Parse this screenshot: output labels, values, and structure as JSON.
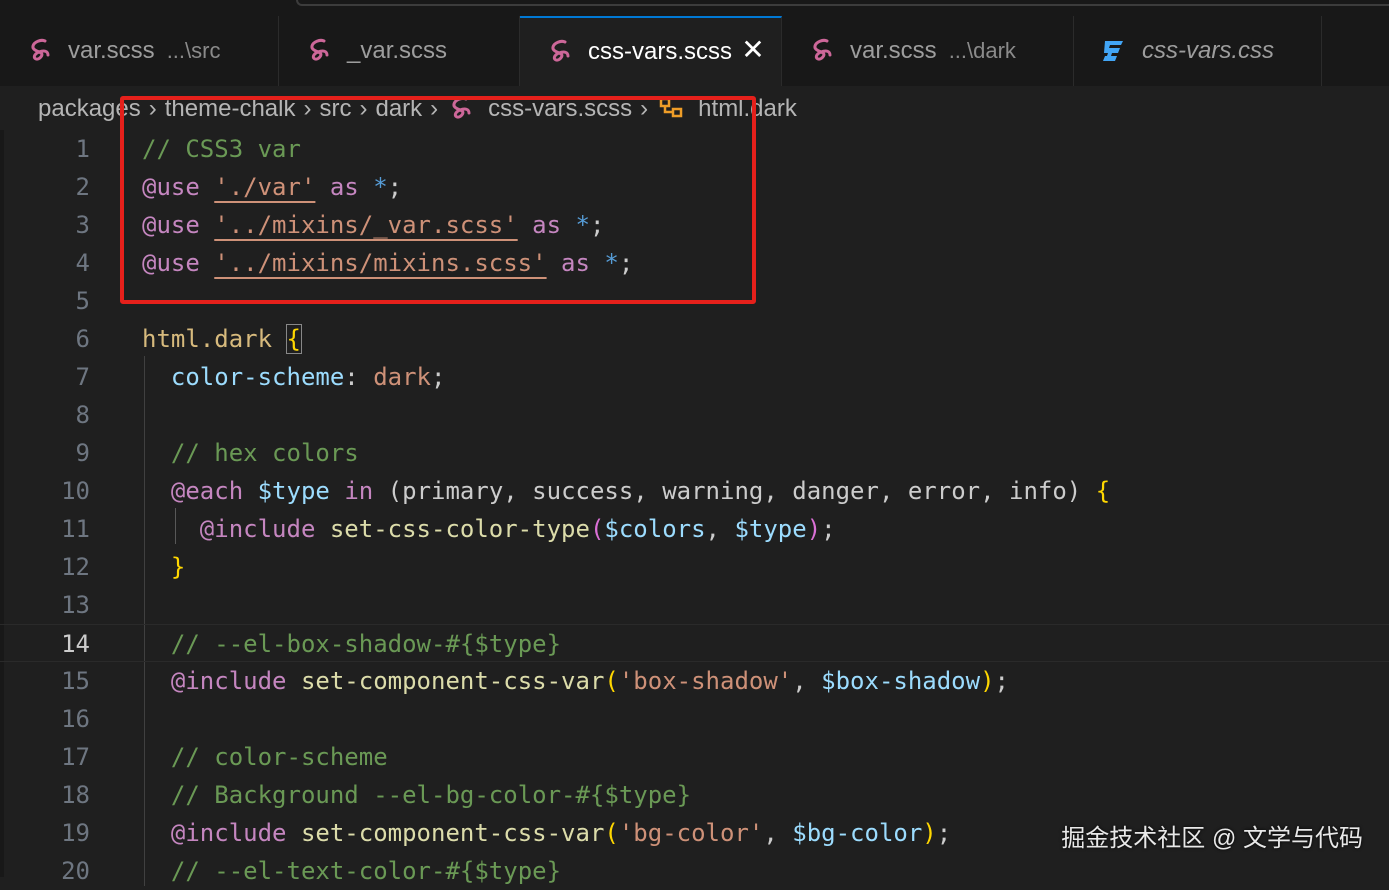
{
  "tabs": [
    {
      "name": "var.scss",
      "desc": "...\\src",
      "icon": "sass-icon",
      "active": false
    },
    {
      "name": "_var.scss",
      "desc": "",
      "icon": "sass-icon",
      "active": false
    },
    {
      "name": "css-vars.scss",
      "desc": "",
      "icon": "sass-icon",
      "active": true
    },
    {
      "name": "var.scss",
      "desc": "...\\dark",
      "icon": "sass-icon",
      "active": false
    },
    {
      "name": "css-vars.css",
      "desc": "",
      "icon": "css3-icon",
      "active": false
    }
  ],
  "breadcrumb": {
    "items": [
      "packages",
      "theme-chalk",
      "src",
      "dark",
      "css-vars.scss",
      "html.dark"
    ]
  },
  "editor": {
    "current_line": "14",
    "line_numbers": [
      "1",
      "2",
      "3",
      "4",
      "5",
      "6",
      "7",
      "8",
      "9",
      "10",
      "11",
      "12",
      "13",
      "14",
      "15",
      "16",
      "17",
      "18",
      "19",
      "20"
    ],
    "lines": {
      "l1": {
        "comment": "// CSS3 var"
      },
      "l2": {
        "at": "@use",
        "str": "'./var'",
        "kw": "as",
        "star": "*",
        "semi": ";"
      },
      "l3": {
        "at": "@use",
        "str": "'../mixins/_var.scss'",
        "kw": "as",
        "star": "*",
        "semi": ";"
      },
      "l4": {
        "at": "@use",
        "str": "'../mixins/mixins.scss'",
        "kw": "as",
        "star": "*",
        "semi": ";"
      },
      "l6": {
        "sel": "html.dark",
        "brace": "{"
      },
      "l7": {
        "prop": "color-scheme",
        "colon": ":",
        "val": "dark",
        "semi": ";"
      },
      "l9": {
        "comment": "// hex colors"
      },
      "l10": {
        "at": "@each",
        "var": "$type",
        "kw": "in",
        "list": "(primary, success, warning, danger, error, info)",
        "brace": "{"
      },
      "l11": {
        "at": "@include",
        "func": "set-css-color-type",
        "open": "(",
        "arg1": "$colors",
        "comma": ", ",
        "arg2": "$type",
        "close": ")",
        "semi": ";"
      },
      "l12": {
        "brace": "}"
      },
      "l14": {
        "comment": "// --el-box-shadow-#{$type}"
      },
      "l15": {
        "at": "@include",
        "func": "set-component-css-var",
        "open": "(",
        "str": "'box-shadow'",
        "comma": ", ",
        "arg": "$box-shadow",
        "close": ")",
        "semi": ";"
      },
      "l17": {
        "comment": "// color-scheme"
      },
      "l18": {
        "comment": "// Background --el-bg-color-#{$type}"
      },
      "l19": {
        "at": "@include",
        "func": "set-component-css-var",
        "open": "(",
        "str": "'bg-color'",
        "comma": ", ",
        "arg": "$bg-color",
        "close": ")",
        "semi": ";"
      },
      "l20": {
        "comment": "// --el-text-color-#{$type}"
      }
    }
  },
  "watermark": "掘金技术社区 @ 文学与代码",
  "colors": {
    "highlight_box": "#e5201b",
    "active_tab_border": "#0078d4",
    "sass": "#cd6799",
    "css3": "#42a5f5"
  }
}
